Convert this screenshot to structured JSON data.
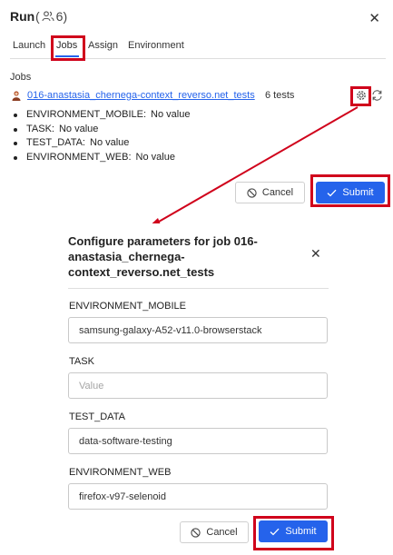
{
  "header": {
    "title": "Run",
    "count_open": "(",
    "count": "6",
    "count_close": ")",
    "people_icon": "people-icon",
    "close_icon": "close-icon"
  },
  "tabs": [
    {
      "label": "Launch",
      "active": false
    },
    {
      "label": "Jobs",
      "active": true
    },
    {
      "label": "Assign",
      "active": false
    },
    {
      "label": "Environment",
      "active": false
    }
  ],
  "jobs_section": {
    "label": "Jobs",
    "job": {
      "name": "016-anastasia_chernega-context_reverso.net_tests",
      "test_count": "6 tests",
      "gear_icon": "gear-icon",
      "refresh_icon": "refresh-icon"
    },
    "params": [
      {
        "key": "ENVIRONMENT_MOBILE:",
        "value": "No value"
      },
      {
        "key": "TASK:",
        "value": "No value"
      },
      {
        "key": "TEST_DATA:",
        "value": "No value"
      },
      {
        "key": "ENVIRONMENT_WEB:",
        "value": "No value"
      }
    ]
  },
  "main_actions": {
    "cancel_label": "Cancel",
    "submit_label": "Submit"
  },
  "dialog": {
    "title": "Configure parameters for job 016-anastasia_chernega-context_reverso.net_tests",
    "fields": [
      {
        "label": "ENVIRONMENT_MOBILE",
        "value": "samsung-galaxy-A52-v11.0-browserstack",
        "placeholder": ""
      },
      {
        "label": "TASK",
        "value": "",
        "placeholder": "Value"
      },
      {
        "label": "TEST_DATA",
        "value": "data-software-testing",
        "placeholder": ""
      },
      {
        "label": "ENVIRONMENT_WEB",
        "value": "firefox-v97-selenoid",
        "placeholder": ""
      }
    ],
    "cancel_label": "Cancel",
    "submit_label": "Submit"
  },
  "colors": {
    "accent": "#2563eb",
    "annotation": "#d0021b"
  }
}
